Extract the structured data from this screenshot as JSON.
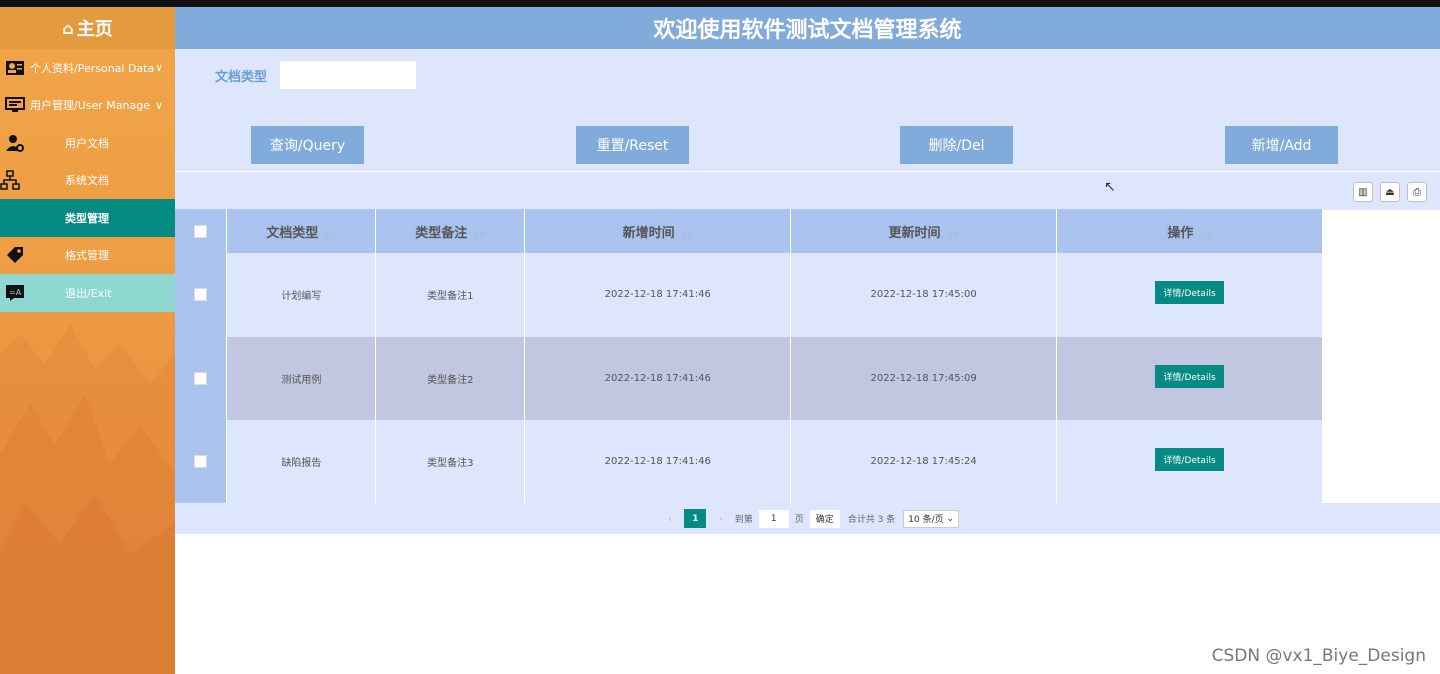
{
  "sidebar": {
    "home": "主页",
    "items": [
      {
        "label": "个人资料/Personal Data",
        "icon": "user-card-icon"
      },
      {
        "label": "用户管理/User Manage",
        "icon": "monitor-icon"
      },
      {
        "label": "用户文档",
        "icon": "user-gear-icon"
      },
      {
        "label": "系统文档",
        "icon": "sitemap-icon"
      },
      {
        "label": "类型管理",
        "icon": ""
      },
      {
        "label": "格式管理",
        "icon": "tag-icon"
      },
      {
        "label": "退出/Exit",
        "icon": "translate-icon"
      }
    ]
  },
  "header": {
    "title": "欢迎使用软件测试文档管理系统"
  },
  "search": {
    "label": "文档类型",
    "value": ""
  },
  "buttons": {
    "query": "查询/Query",
    "reset": "重置/Reset",
    "del": "删除/Del",
    "add": "新增/Add"
  },
  "table": {
    "columns": [
      "文档类型",
      "类型备注",
      "新增时间",
      "更新时间",
      "操作"
    ],
    "rows": [
      {
        "type": "计划编写",
        "note": "类型备注1",
        "created": "2022-12-18 17:41:46",
        "updated": "2022-12-18 17:45:00",
        "action": "详情/Details"
      },
      {
        "type": "测试用例",
        "note": "类型备注2",
        "created": "2022-12-18 17:41:46",
        "updated": "2022-12-18 17:45:09",
        "action": "详情/Details"
      },
      {
        "type": "缺陷报告",
        "note": "类型备注3",
        "created": "2022-12-18 17:41:46",
        "updated": "2022-12-18 17:45:24",
        "action": "详情/Details"
      }
    ]
  },
  "pager": {
    "current": "1",
    "goto_label": "到第",
    "goto_value": "1",
    "page_unit": "页",
    "confirm": "确定",
    "total": "合计共 3 条",
    "per_page": "10 条/页"
  },
  "watermark": "CSDN @vx1_Biye_Design",
  "colors": {
    "teal": "#058a84",
    "blue": "#80abdb",
    "orange": "#ee9d45"
  }
}
